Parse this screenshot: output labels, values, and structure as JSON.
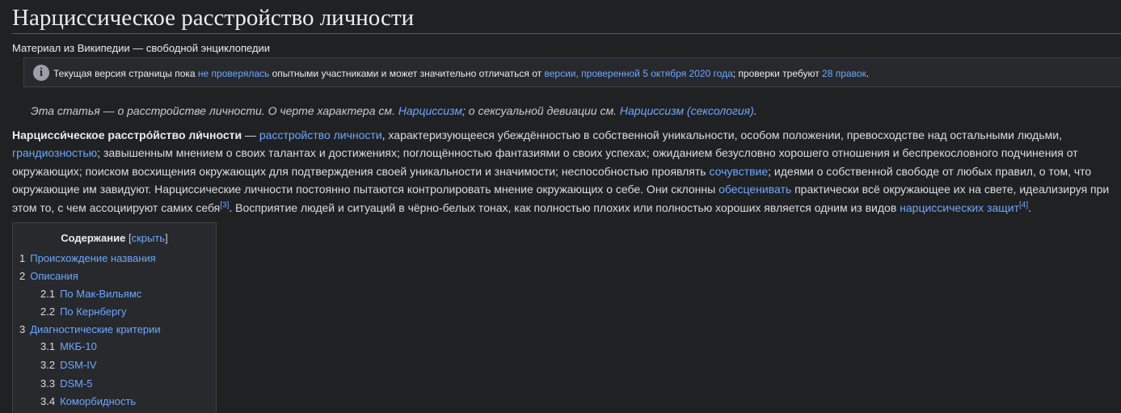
{
  "title": "Нарциссическое расстройство личности",
  "subtitle": "Материал из Википедии — свободной энциклопедии",
  "notice": {
    "icon": "info-icon",
    "text_1": "Текущая версия страницы пока ",
    "link_1": "не проверялась",
    "text_2": " опытными участниками и может значительно отличаться от ",
    "link_2": "версии, проверенной 5 октября 2020 года",
    "text_3": "; проверки требуют ",
    "link_3": "28 правок",
    "text_4": "."
  },
  "hatnote": {
    "text_1": "Эта статья — о расстройстве личности. О черте характера см. ",
    "link_1": "Нарциссизм",
    "text_2": "; о сексуальной девиации см. ",
    "link_2": "Нарциссизм (сексология)",
    "text_3": "."
  },
  "lead": {
    "bold": "Нарцисси́ческое расстро́йство ли́чности",
    "t1": " — ",
    "l1": "расстройство личности",
    "t2": ", характеризующееся убеждённостью в собственной уникальности, особом положении, превосходстве над остальными людьми, ",
    "l2": "грандиозностью",
    "t3": "; завышенным мнением о своих талантах и достижениях; поглощённостью фантазиями о своих успехах; ожиданием безусловно хорошего отношения и беспрекословного подчинения от окружающих; поиском восхищения окружающих для подтверждения своей уникальности и значимости; неспособностью проявлять ",
    "l3": "сочувствие",
    "t4": "; идеями о собственной свободе от любых правил, о том, что окружающие им завидуют. Нарциссические личности постоянно пытаются контролировать мнение окружающих о себе. Они склонны ",
    "l4": "обесценивать",
    "t5": " практически всё окружающее их на свете, идеализируя при этом то, с чем ассоциируют самих себя",
    "ref1": "[3]",
    "t6": ". Восприятие людей и ситуаций в чёрно-белых тонах, как полностью плохих или полностью хороших является одним из видов ",
    "l5": "нарциссических защит",
    "ref2": "[4]",
    "t7": "."
  },
  "toc": {
    "title": "Содержание",
    "bracket_open": " [",
    "toggle": "скрыть",
    "bracket_close": "]",
    "items": [
      {
        "num": "1",
        "label": "Происхождение названия"
      },
      {
        "num": "2",
        "label": "Описания"
      },
      {
        "num": "2.1",
        "label": "По Мак-Вильямс"
      },
      {
        "num": "2.2",
        "label": "По Кернбергу"
      },
      {
        "num": "3",
        "label": "Диагностические критерии"
      },
      {
        "num": "3.1",
        "label": "МКБ-10"
      },
      {
        "num": "3.2",
        "label": "DSM-IV"
      },
      {
        "num": "3.3",
        "label": "DSM-5"
      },
      {
        "num": "3.4",
        "label": "Коморбидность"
      }
    ]
  },
  "colors": {
    "background": "#202122",
    "link": "#6da8ff",
    "text": "#eaecf0",
    "box": "#27292d"
  }
}
